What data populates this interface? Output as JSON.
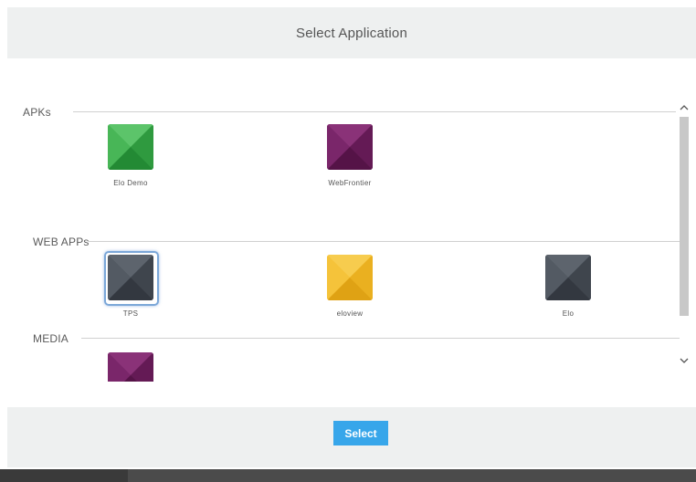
{
  "header": {
    "title": "Select Application"
  },
  "sections": [
    {
      "name": "APKs",
      "apps": [
        {
          "label": "Elo Demo",
          "color": "#3aaa4a"
        },
        {
          "label": "WebFrontier",
          "color": "#6e1f5e"
        }
      ]
    },
    {
      "name": "WEB APPs",
      "apps": [
        {
          "label": "TPS",
          "color": "#474d56",
          "selected": true
        },
        {
          "label": "eloview",
          "color": "#f3bc2a"
        },
        {
          "label": "Elo",
          "color": "#474d56"
        }
      ]
    },
    {
      "name": "MEDIA",
      "apps": [
        {
          "label": "",
          "color": "#6e1f5e"
        }
      ]
    }
  ],
  "footer": {
    "select_label": "Select"
  },
  "icons": {
    "scroll_up": "chevron-up-icon",
    "scroll_down": "chevron-down-icon"
  },
  "colors": {
    "accent": "#37a6ea",
    "selection": "#7ba7d8"
  }
}
